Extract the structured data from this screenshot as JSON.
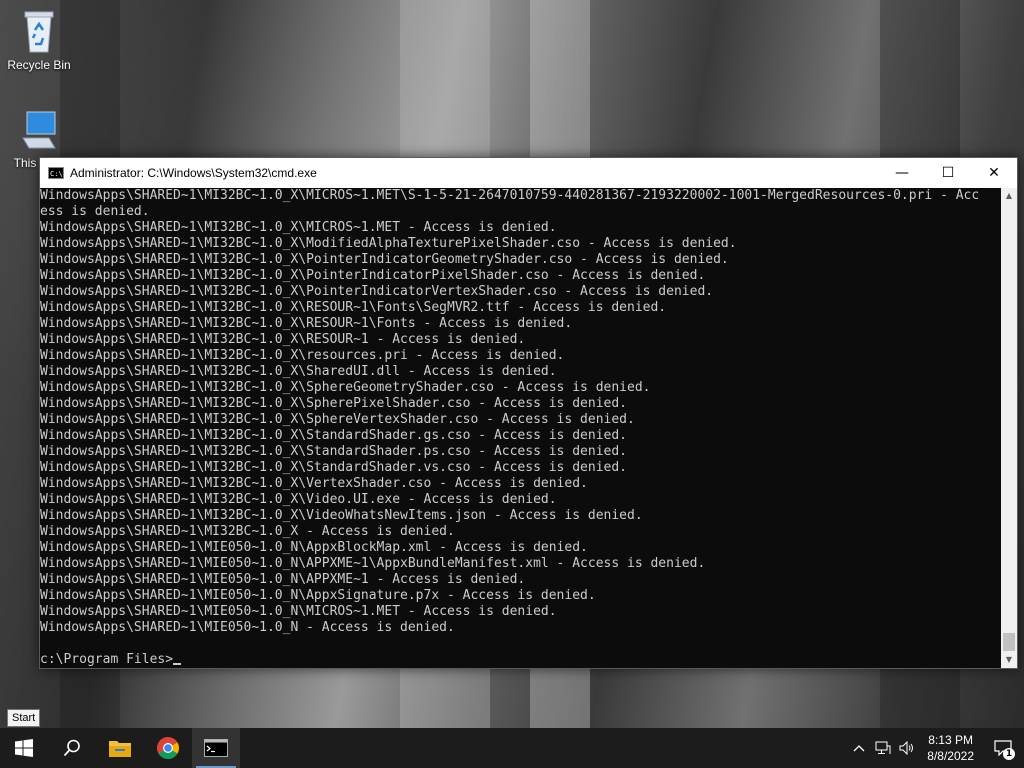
{
  "desktop": {
    "icons": [
      {
        "label": "Recycle Bin"
      },
      {
        "label": "This"
      }
    ]
  },
  "cmd_window": {
    "title": "Administrator: C:\\Windows\\System32\\cmd.exe",
    "controls": {
      "minimize": "—",
      "maximize": "☐",
      "close": "✕"
    },
    "lines": [
      "WindowsApps\\SHARED~1\\MI32BC~1.0_X\\MICROS~1.MET\\S-1-5-21-2647010759-440281367-2193220002-1001-MergedResources-0.pri - Acc",
      "ess is denied.",
      "WindowsApps\\SHARED~1\\MI32BC~1.0_X\\MICROS~1.MET - Access is denied.",
      "WindowsApps\\SHARED~1\\MI32BC~1.0_X\\ModifiedAlphaTexturePixelShader.cso - Access is denied.",
      "WindowsApps\\SHARED~1\\MI32BC~1.0_X\\PointerIndicatorGeometryShader.cso - Access is denied.",
      "WindowsApps\\SHARED~1\\MI32BC~1.0_X\\PointerIndicatorPixelShader.cso - Access is denied.",
      "WindowsApps\\SHARED~1\\MI32BC~1.0_X\\PointerIndicatorVertexShader.cso - Access is denied.",
      "WindowsApps\\SHARED~1\\MI32BC~1.0_X\\RESOUR~1\\Fonts\\SegMVR2.ttf - Access is denied.",
      "WindowsApps\\SHARED~1\\MI32BC~1.0_X\\RESOUR~1\\Fonts - Access is denied.",
      "WindowsApps\\SHARED~1\\MI32BC~1.0_X\\RESOUR~1 - Access is denied.",
      "WindowsApps\\SHARED~1\\MI32BC~1.0_X\\resources.pri - Access is denied.",
      "WindowsApps\\SHARED~1\\MI32BC~1.0_X\\SharedUI.dll - Access is denied.",
      "WindowsApps\\SHARED~1\\MI32BC~1.0_X\\SphereGeometryShader.cso - Access is denied.",
      "WindowsApps\\SHARED~1\\MI32BC~1.0_X\\SpherePixelShader.cso - Access is denied.",
      "WindowsApps\\SHARED~1\\MI32BC~1.0_X\\SphereVertexShader.cso - Access is denied.",
      "WindowsApps\\SHARED~1\\MI32BC~1.0_X\\StandardShader.gs.cso - Access is denied.",
      "WindowsApps\\SHARED~1\\MI32BC~1.0_X\\StandardShader.ps.cso - Access is denied.",
      "WindowsApps\\SHARED~1\\MI32BC~1.0_X\\StandardShader.vs.cso - Access is denied.",
      "WindowsApps\\SHARED~1\\MI32BC~1.0_X\\VertexShader.cso - Access is denied.",
      "WindowsApps\\SHARED~1\\MI32BC~1.0_X\\Video.UI.exe - Access is denied.",
      "WindowsApps\\SHARED~1\\MI32BC~1.0_X\\VideoWhatsNewItems.json - Access is denied.",
      "WindowsApps\\SHARED~1\\MI32BC~1.0_X - Access is denied.",
      "WindowsApps\\SHARED~1\\MIE050~1.0_N\\AppxBlockMap.xml - Access is denied.",
      "WindowsApps\\SHARED~1\\MIE050~1.0_N\\APPXME~1\\AppxBundleManifest.xml - Access is denied.",
      "WindowsApps\\SHARED~1\\MIE050~1.0_N\\APPXME~1 - Access is denied.",
      "WindowsApps\\SHARED~1\\MIE050~1.0_N\\AppxSignature.p7x - Access is denied.",
      "WindowsApps\\SHARED~1\\MIE050~1.0_N\\MICROS~1.MET - Access is denied.",
      "WindowsApps\\SHARED~1\\MIE050~1.0_N - Access is denied.",
      "",
      "c:\\Program Files>"
    ]
  },
  "tooltip": {
    "label": "Start"
  },
  "taskbar": {
    "apps": [
      {
        "name": "start",
        "icon": "windows-logo-icon"
      },
      {
        "name": "search",
        "icon": "search-icon"
      },
      {
        "name": "file-explorer",
        "icon": "folder-icon"
      },
      {
        "name": "chrome",
        "icon": "chrome-icon"
      },
      {
        "name": "cmd",
        "icon": "cmd-icon",
        "active": true
      }
    ],
    "clock": {
      "time": "8:13 PM",
      "date": "8/8/2022"
    },
    "notification_count": "1"
  }
}
